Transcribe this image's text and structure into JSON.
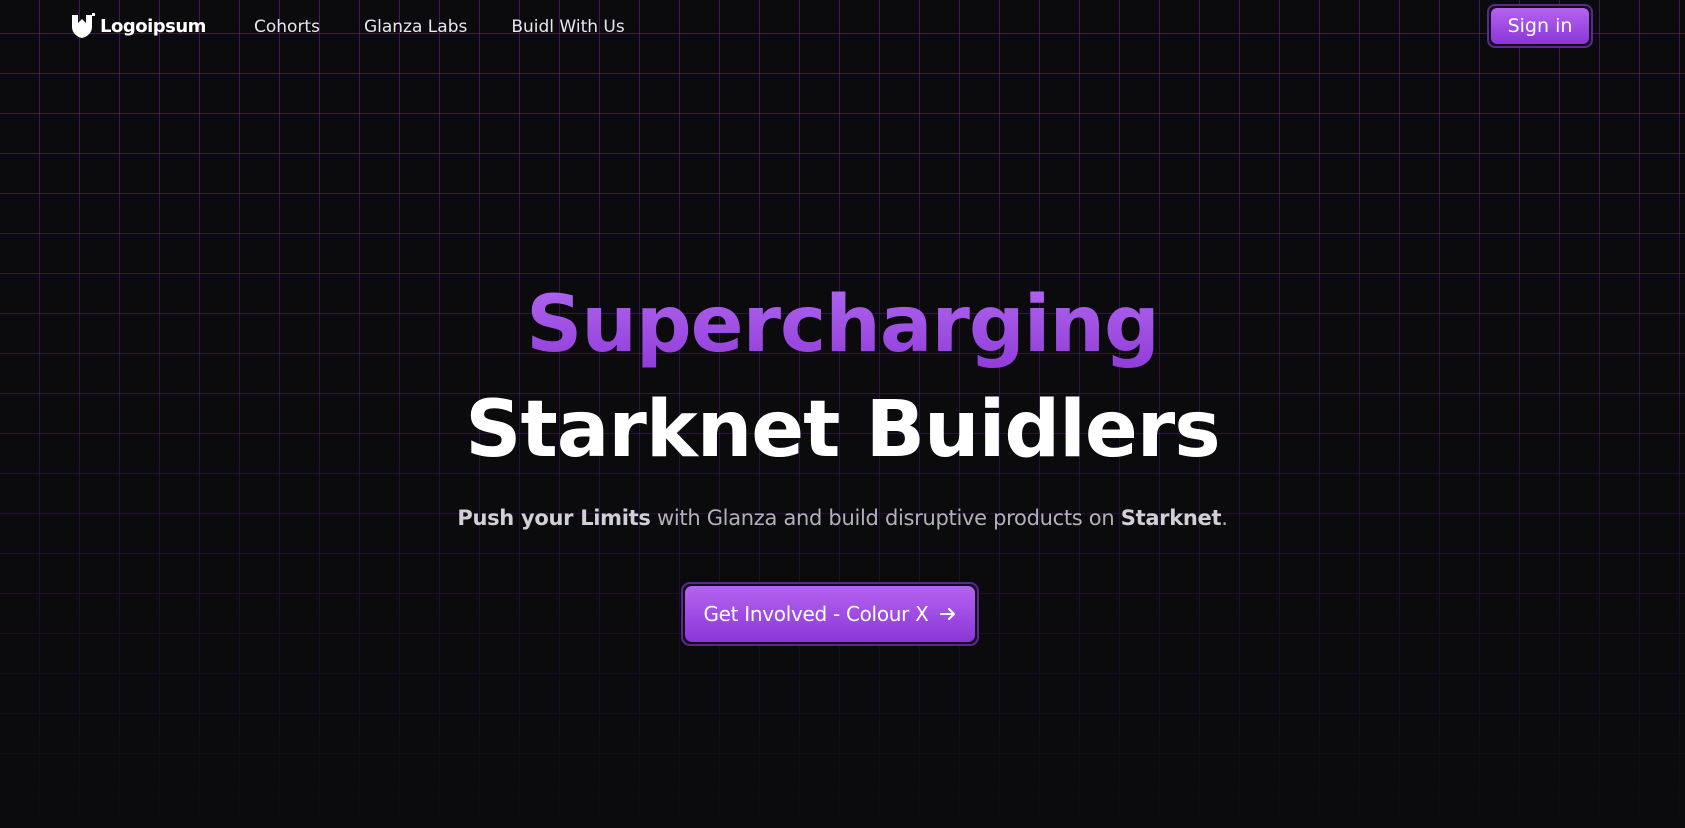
{
  "nav": {
    "logo_text": "Logoipsum",
    "links": [
      "Cohorts",
      "Glanza Labs",
      "Buidl With Us"
    ],
    "signin_label": "Sign in"
  },
  "hero": {
    "headline_line1": "Supercharging",
    "headline_line2": "Starknet Buidlers",
    "subtitle": {
      "strong1": "Push your Limits",
      "mid": " with Glanza and build disruptive products on ",
      "strong2": "Starknet",
      "end": "."
    },
    "cta_label": "Get Involved - Colour X",
    "cta_icon": "arrow-right-icon"
  },
  "colors": {
    "background": "#0b0a0d",
    "grid": "#7832be",
    "accent": "#a04de4",
    "button_top": "#b563f0",
    "button_bottom": "#8a36d8"
  }
}
